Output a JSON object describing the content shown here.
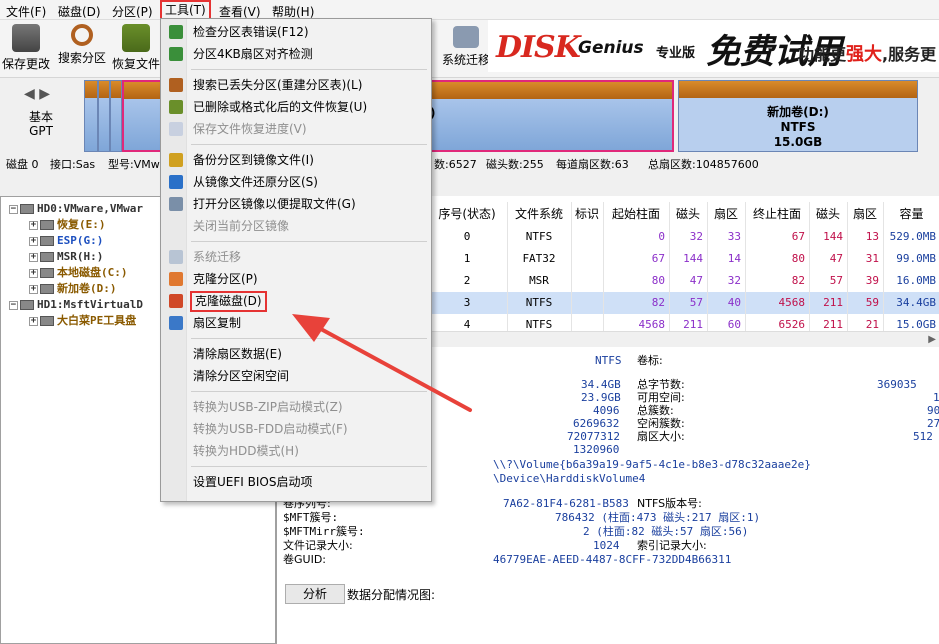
{
  "menubar": {
    "items": [
      "文件(F)",
      "磁盘(D)",
      "分区(P)",
      "工具(T)",
      "查看(V)",
      "帮助(H)"
    ]
  },
  "toolbar": {
    "buttons": [
      "保存更改",
      "搜索分区",
      "恢复文件",
      "系统迁移"
    ]
  },
  "banner": {
    "brand_dk": "DISK",
    "brand_genius": "Genius",
    "brand_edition": "专业版",
    "brand_free": "免费试用",
    "slogan_a": "功能更",
    "slogan_b": "强大",
    "slogan_c": ",服务更"
  },
  "diskmap": {
    "nav": "◀ ▶",
    "kind_a": "基本",
    "kind_b": "GPT",
    "part_c_fragment": ")",
    "part_d_name": "新加卷(D:)",
    "part_d_fs": "NTFS",
    "part_d_size": "15.0GB"
  },
  "diskinfo": {
    "disk": "磁盘 0",
    "iface": "接口:Sas",
    "model": "型号:VMwa",
    "cylinders": "数:6527",
    "heads": "磁头数:255",
    "sectors": "每道扇区数:63",
    "total": "总扇区数:104857600"
  },
  "tree": {
    "rows": [
      {
        "text": "HD0:VMware,VMwar",
        "indent": 0,
        "cls": "c-dark",
        "box": "-"
      },
      {
        "text": "恢复(E:)",
        "indent": 1,
        "cls": "c-brown",
        "box": "+"
      },
      {
        "text": "ESP(G:)",
        "indent": 1,
        "cls": "c-blue",
        "box": "+"
      },
      {
        "text": "MSR(H:)",
        "indent": 1,
        "cls": "c-dark",
        "box": "+"
      },
      {
        "text": "本地磁盘(C:)",
        "indent": 1,
        "cls": "c-brown",
        "box": "+"
      },
      {
        "text": "新加卷(D:)",
        "indent": 1,
        "cls": "c-brown",
        "box": "+"
      },
      {
        "text": "HD1:MsftVirtualD",
        "indent": 0,
        "cls": "c-dark",
        "box": "-"
      },
      {
        "text": "大白菜PE工具盘",
        "indent": 1,
        "cls": "c-brown",
        "box": "+"
      }
    ]
  },
  "table": {
    "headers": [
      "序号(状态)",
      "文件系统",
      "标识",
      "起始柱面",
      "磁头",
      "扇区",
      "终止柱面",
      "磁头",
      "扇区",
      "容量"
    ],
    "rows": [
      [
        "0",
        "NTFS",
        "",
        "0",
        "32",
        "33",
        "67",
        "144",
        "13",
        "529.0MB"
      ],
      [
        "1",
        "FAT32",
        "",
        "67",
        "144",
        "14",
        "80",
        "47",
        "31",
        "99.0MB"
      ],
      [
        "2",
        "MSR",
        "",
        "80",
        "47",
        "32",
        "82",
        "57",
        "39",
        "16.0MB"
      ],
      [
        "3",
        "NTFS",
        "",
        "82",
        "57",
        "40",
        "4568",
        "211",
        "59",
        "34.4GB"
      ],
      [
        "4",
        "NTFS",
        "",
        "4568",
        "211",
        "60",
        "6526",
        "211",
        "21",
        "15.0GB"
      ]
    ],
    "selected_row": 3
  },
  "details": {
    "fs": "NTFS",
    "vol_label_k": "卷标:",
    "total_size": "34.4GB",
    "total_bytes_k": "总字节数:",
    "total_bytes_v": "369035",
    "free": "23.9GB",
    "free_k": "可用空间:",
    "free_v": "1",
    "cluster_size": "4096",
    "total_clusters_k": "总簇数:",
    "total_clusters_v": "90",
    "free_clusters": "6269632",
    "free_clusters_k": "空闲簇数:",
    "free_clusters_v": "27",
    "sectors": "72077312",
    "sector_size_k": "扇区大小:",
    "sector_size_v": "512",
    "v1320960": "1320960",
    "guid_path": "\\\\?\\Volume{b6a39a19-9af5-4c1e-b8e3-d78c32aaae2e}",
    "dev_path": "\\Device\\HarddiskVolume4",
    "serial_k": "卷序列号:",
    "serial_v": "7A62-81F4-6281-B583",
    "ntfsver_k": "NTFS版本号:",
    "mft_k": "$MFT簇号:",
    "mft_v": "786432 (柱面:473 磁头:217 扇区:1)",
    "mftmirr_k": "$MFTMirr簇号:",
    "mftmirr_v": "2 (柱面:82 磁头:57 扇区:56)",
    "rec_k": "文件记录大小:",
    "rec_v": "1024",
    "idx_k": "索引记录大小:",
    "guid_k": "卷GUID:",
    "guid_v": "46779EAE-AEED-4487-8CFF-732DD4B66311",
    "analyze": "分析",
    "analyze_lbl": "数据分配情况图:"
  },
  "menu": {
    "items": [
      {
        "label": "检查分区表错误(F12)",
        "disabled": false,
        "icon": "#3a8f3a"
      },
      {
        "label": "分区4KB扇区对齐检测",
        "disabled": false,
        "icon": "#3a8f3a"
      },
      {
        "sep": true
      },
      {
        "label": "搜索已丢失分区(重建分区表)(L)",
        "disabled": false,
        "icon": "#b06020"
      },
      {
        "label": "已删除或格式化后的文件恢复(U)",
        "disabled": false,
        "icon": "#6a8f2a"
      },
      {
        "label": "保存文件恢复进度(V)",
        "disabled": true,
        "icon": "#c8d0e0"
      },
      {
        "sep": true
      },
      {
        "label": "备份分区到镜像文件(I)",
        "disabled": false,
        "icon": "#d0a020"
      },
      {
        "label": "从镜像文件还原分区(S)",
        "disabled": false,
        "icon": "#2a70c8"
      },
      {
        "label": "打开分区镜像以便提取文件(G)",
        "disabled": false,
        "icon": "#7a8fa8"
      },
      {
        "label": "关闭当前分区镜像",
        "disabled": true,
        "icon": ""
      },
      {
        "sep": true
      },
      {
        "label": "系统迁移",
        "disabled": true,
        "icon": "#b8c4d4"
      },
      {
        "label": "克隆分区(P)",
        "disabled": false,
        "icon": "#e07830"
      },
      {
        "label": "克隆磁盘(D)",
        "disabled": false,
        "icon": "#d04828",
        "highlight": true
      },
      {
        "label": "扇区复制",
        "disabled": false,
        "icon": "#3a78c8"
      },
      {
        "sep": true
      },
      {
        "label": "清除扇区数据(E)",
        "disabled": false,
        "icon": ""
      },
      {
        "label": "清除分区空闲空间",
        "disabled": false,
        "icon": ""
      },
      {
        "sep": true
      },
      {
        "label": "转换为USB-ZIP启动模式(Z)",
        "disabled": true,
        "icon": ""
      },
      {
        "label": "转换为USB-FDD启动模式(F)",
        "disabled": true,
        "icon": ""
      },
      {
        "label": "转换为HDD模式(H)",
        "disabled": true,
        "icon": ""
      },
      {
        "sep": true
      },
      {
        "label": "设置UEFI BIOS启动项",
        "disabled": false,
        "icon": ""
      }
    ]
  },
  "colors": {
    "highlight_red": "#e53333",
    "arrow_red": "#e8423a",
    "selection": "#cfe0f7"
  }
}
